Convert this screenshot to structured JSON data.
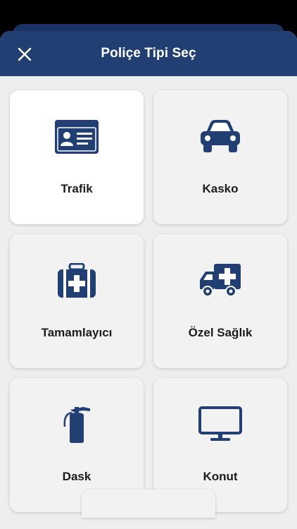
{
  "header": {
    "title": "Poliçe Tipi Seç",
    "close_icon": "close-icon"
  },
  "colors": {
    "brand": "#223f73",
    "icon": "#223f73",
    "sheet_bg": "#eeeeef",
    "card_bg": "#f2f2f2",
    "card_selected_bg": "#ffffff"
  },
  "policy_types": [
    {
      "label": "Trafik",
      "icon": "id-card-icon",
      "selected": true
    },
    {
      "label": "Kasko",
      "icon": "car-icon",
      "selected": false
    },
    {
      "label": "Tamamlayıcı",
      "icon": "medical-kit-icon",
      "selected": false
    },
    {
      "label": "Özel Sağlık",
      "icon": "ambulance-icon",
      "selected": false
    },
    {
      "label": "Dask",
      "icon": "fire-extinguisher-icon",
      "selected": false
    },
    {
      "label": "Konut",
      "icon": "monitor-icon",
      "selected": false
    }
  ]
}
